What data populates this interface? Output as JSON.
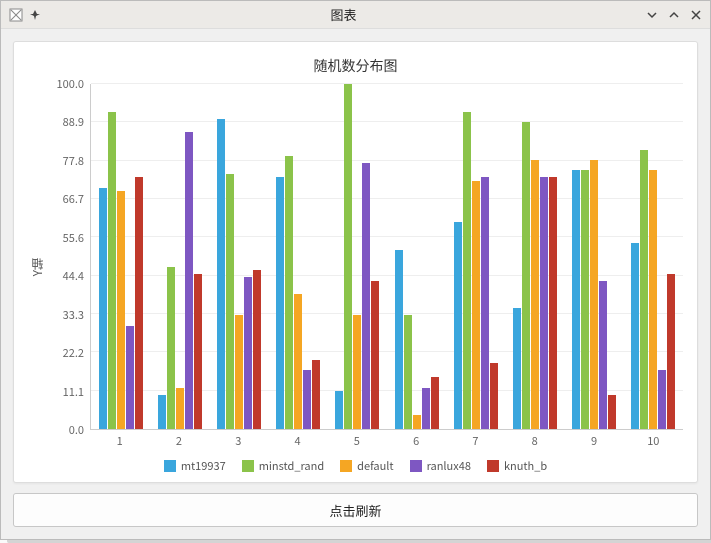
{
  "window": {
    "title": "图表"
  },
  "buttons": {
    "refresh": "点击刷新"
  },
  "chart_data": {
    "type": "bar",
    "title": "随机数分布图",
    "xlabel": "",
    "ylabel": "Y轴",
    "ylim": [
      0,
      100
    ],
    "yticks": [
      "0.0",
      "11.1",
      "22.2",
      "33.3",
      "44.4",
      "55.6",
      "66.7",
      "77.8",
      "88.9",
      "100.0"
    ],
    "categories": [
      "1",
      "2",
      "3",
      "4",
      "5",
      "6",
      "7",
      "8",
      "9",
      "10"
    ],
    "series": [
      {
        "name": "mt19937",
        "color": "#3aa6dd",
        "values": [
          70,
          10,
          90,
          73,
          11,
          52,
          60,
          35,
          75,
          54
        ]
      },
      {
        "name": "minstd_rand",
        "color": "#8bc34a",
        "values": [
          92,
          47,
          74,
          79,
          100,
          33,
          92,
          89,
          75,
          81
        ]
      },
      {
        "name": "default",
        "color": "#f5a623",
        "values": [
          69,
          12,
          33,
          39,
          33,
          4,
          72,
          78,
          78,
          75
        ]
      },
      {
        "name": "ranlux48",
        "color": "#7e57c2",
        "values": [
          30,
          86,
          44,
          17,
          77,
          12,
          73,
          73,
          43,
          17
        ]
      },
      {
        "name": "knuth_b",
        "color": "#c0392b",
        "values": [
          73,
          45,
          46,
          20,
          43,
          15,
          19,
          73,
          10,
          45
        ]
      }
    ]
  }
}
